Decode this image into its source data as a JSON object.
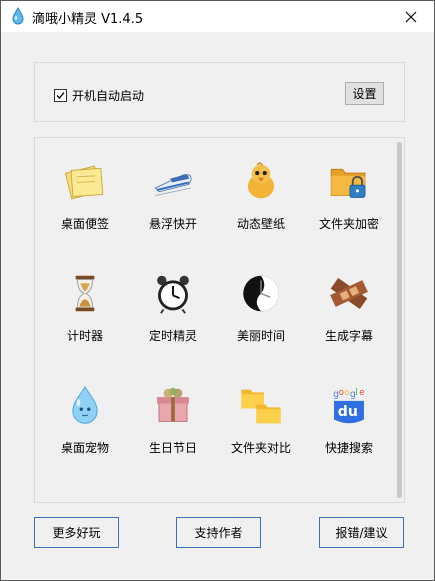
{
  "window": {
    "title": "滴哦小精灵 V1.4.5"
  },
  "startup": {
    "checkbox_label": "开机自动启动",
    "checked": true,
    "settings_label": "设置"
  },
  "tools": [
    {
      "label": "桌面便签",
      "icon": "sticky-note-icon"
    },
    {
      "label": "悬浮快开",
      "icon": "bullet-train-icon"
    },
    {
      "label": "动态壁纸",
      "icon": "chick-icon"
    },
    {
      "label": "文件夹加密",
      "icon": "folder-lock-icon"
    },
    {
      "label": "计时器",
      "icon": "hourglass-icon"
    },
    {
      "label": "定时精灵",
      "icon": "alarm-clock-icon"
    },
    {
      "label": "美丽时间",
      "icon": "clock-face-icon"
    },
    {
      "label": "生成字幕",
      "icon": "film-strip-icon"
    },
    {
      "label": "桌面宠物",
      "icon": "water-drop-pet-icon"
    },
    {
      "label": "生日节日",
      "icon": "gift-box-icon"
    },
    {
      "label": "文件夹对比",
      "icon": "folders-compare-icon"
    },
    {
      "label": "快捷搜索",
      "icon": "baidu-search-icon"
    }
  ],
  "footer": {
    "more_fun": "更多好玩",
    "support_author": "支持作者",
    "report_bug": "报错/建议"
  }
}
